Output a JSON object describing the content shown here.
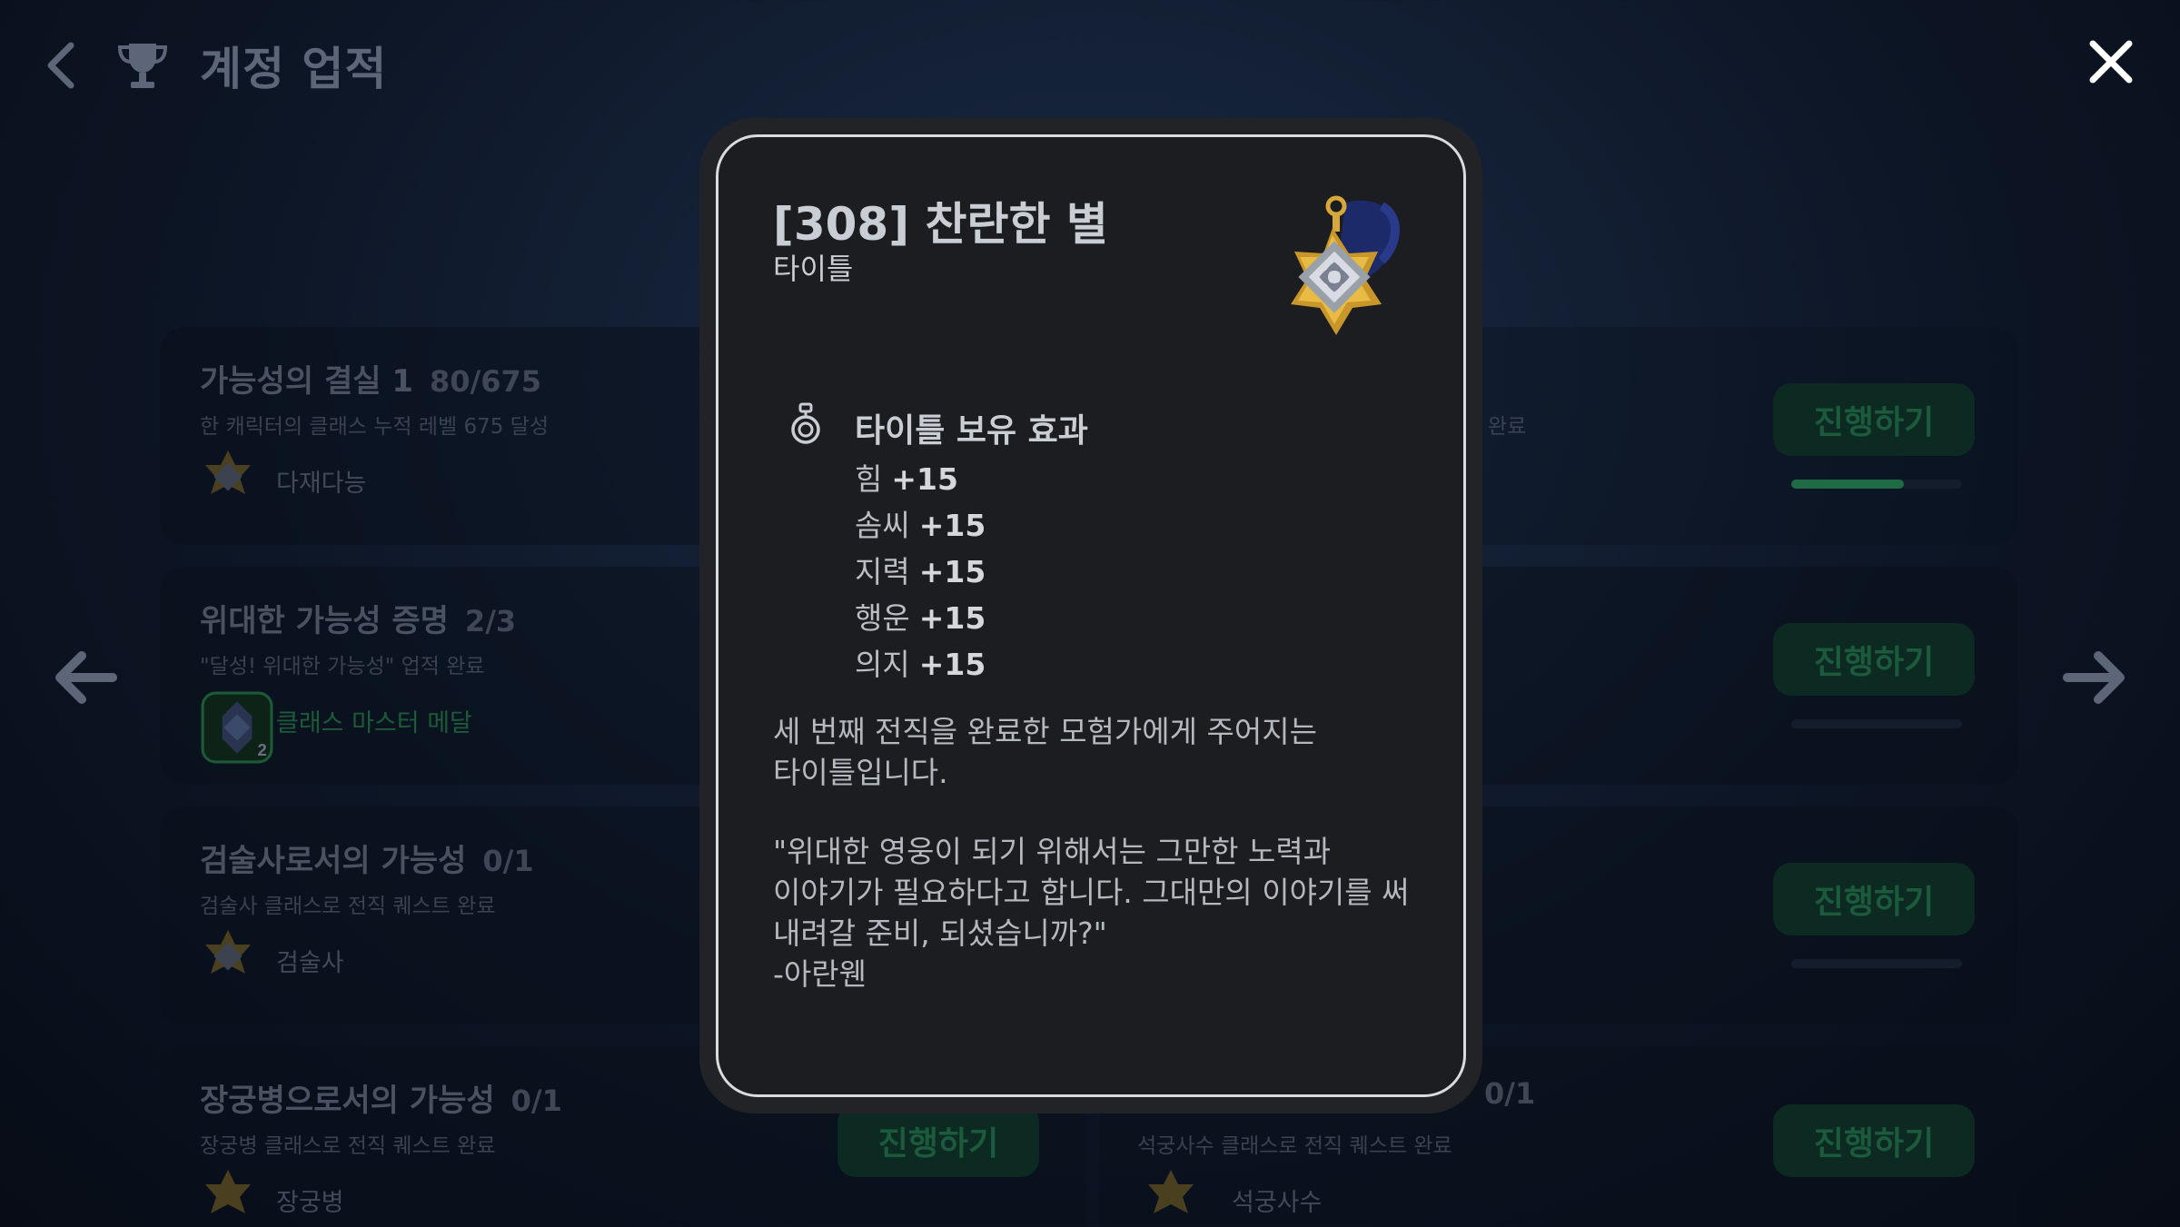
{
  "header": {
    "title": "계정 업적"
  },
  "cards_left": [
    {
      "title": "가능성의 결실 1",
      "progress_current": "80",
      "progress_total": "/675",
      "desc": "한 캐릭터의 클래스 누적 레벨 675 달성",
      "reward": "다재다능"
    },
    {
      "title": "위대한 가능성 증명",
      "progress_current": "2",
      "progress_total": "/3",
      "desc": "\"달성! 위대한 가능성\" 업적 완료",
      "reward": "클래스 마스터 메달",
      "reward_badge": "2"
    },
    {
      "title": "검술사로서의 가능성",
      "progress_current": "0",
      "progress_total": "/1",
      "desc": "검술사 클래스로 전직 퀘스트 완료",
      "reward": "검술사"
    },
    {
      "title": "장궁병으로서의 가능성",
      "progress_current": "0",
      "progress_total": "/1",
      "desc": "장궁병 클래스로 전직 퀘스트 완료",
      "reward": "장궁병"
    }
  ],
  "cards_right": {
    "row1_desc_tail": "완료",
    "row4_progress": "0/1",
    "row4_desc": "석궁사수 클래스로 전직 퀘스트 완료",
    "row4_reward": "석궁사수",
    "row1_progress_fraction": 0.66
  },
  "buttons": {
    "go_label": "진행하기"
  },
  "modal": {
    "title": "[308] 찬란한 별",
    "subtitle": "타이틀",
    "effect_title": "타이틀 보유 효과",
    "stats": [
      {
        "name": "힘",
        "value": "+15"
      },
      {
        "name": "솜씨",
        "value": "+15"
      },
      {
        "name": "지력",
        "value": "+15"
      },
      {
        "name": "행운",
        "value": "+15"
      },
      {
        "name": "의지",
        "value": "+15"
      }
    ],
    "desc_lines_1": [
      "세 번째 전직을 완료한 모험가에게 주어지는",
      "타이틀입니다."
    ],
    "desc_lines_2": [
      "\"위대한 영웅이 되기 위해서는 그만한 노력과",
      "이야기가 필요하다고 합니다. 그대만의 이야기를 써",
      "내려갈 준비, 되셨습니까?\"",
      "-아란웬"
    ]
  },
  "icons": {
    "back": "chevron-left-icon",
    "trophy": "trophy-icon",
    "close": "close-icon",
    "prev": "arrow-left-icon",
    "next": "arrow-right-icon",
    "medal": "star-medal-icon",
    "effect": "medal-effect-icon"
  },
  "colors": {
    "accent_green": "#1e6b45",
    "modal_border": "#d9dbe0"
  }
}
